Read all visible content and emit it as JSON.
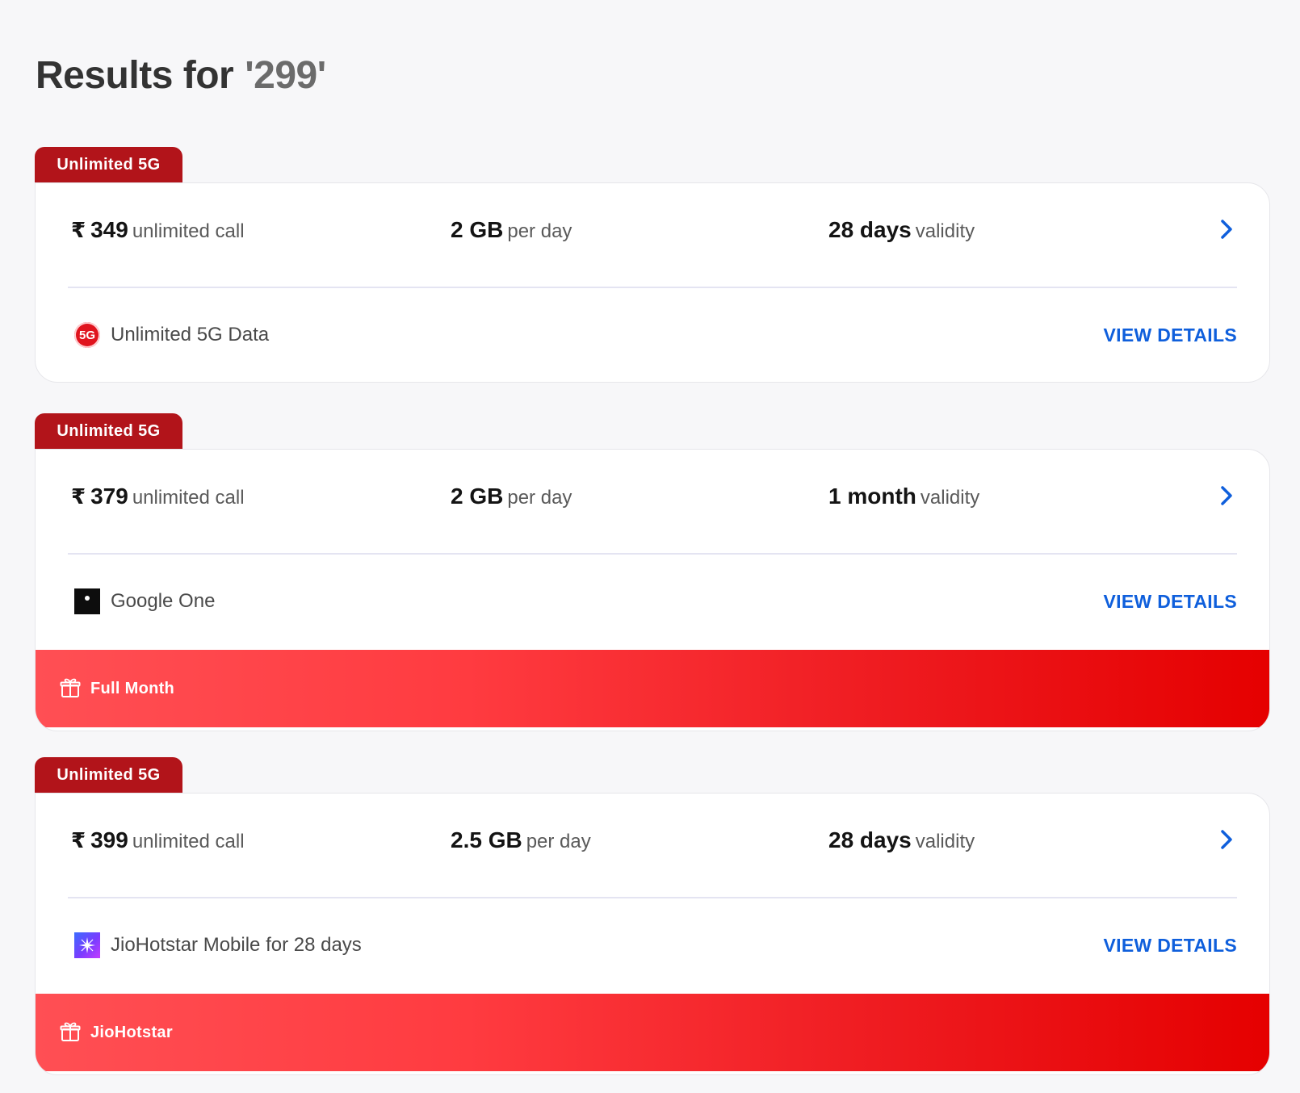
{
  "search": {
    "title_prefix": "Results for",
    "query": "'299'"
  },
  "plans": [
    {
      "tag": "Unlimited 5G",
      "currency": "₹",
      "price": "349",
      "price_suffix": "unlimited call",
      "data": "2 GB",
      "data_suffix": "per day",
      "validity": "28 days",
      "validity_suffix": "validity",
      "benefit_icon": "5g-icon",
      "benefit_icon_text": "5G",
      "benefit": "Unlimited 5G Data",
      "view_details": "VIEW DETAILS",
      "promo": null
    },
    {
      "tag": "Unlimited 5G",
      "currency": "₹",
      "price": "379",
      "price_suffix": "unlimited call",
      "data": "2 GB",
      "data_suffix": "per day",
      "validity": "1 month",
      "validity_suffix": "validity",
      "benefit_icon": "google-one-icon",
      "benefit": "Google One",
      "view_details": "VIEW DETAILS",
      "promo": "Full Month"
    },
    {
      "tag": "Unlimited 5G",
      "currency": "₹",
      "price": "399",
      "price_suffix": "unlimited call",
      "data": "2.5 GB",
      "data_suffix": "per day",
      "validity": "28 days",
      "validity_suffix": "validity",
      "benefit_icon": "jiohotstar-icon",
      "benefit": "JioHotstar Mobile for 28 days",
      "view_details": "VIEW DETAILS",
      "promo": "JioHotstar"
    }
  ],
  "colors": {
    "background": "#f7f7f9",
    "tag": "#b2141a",
    "link": "#0f5fdc",
    "promo_start": "#ff4f54",
    "promo_end": "#e50000",
    "heading": "#333333"
  }
}
